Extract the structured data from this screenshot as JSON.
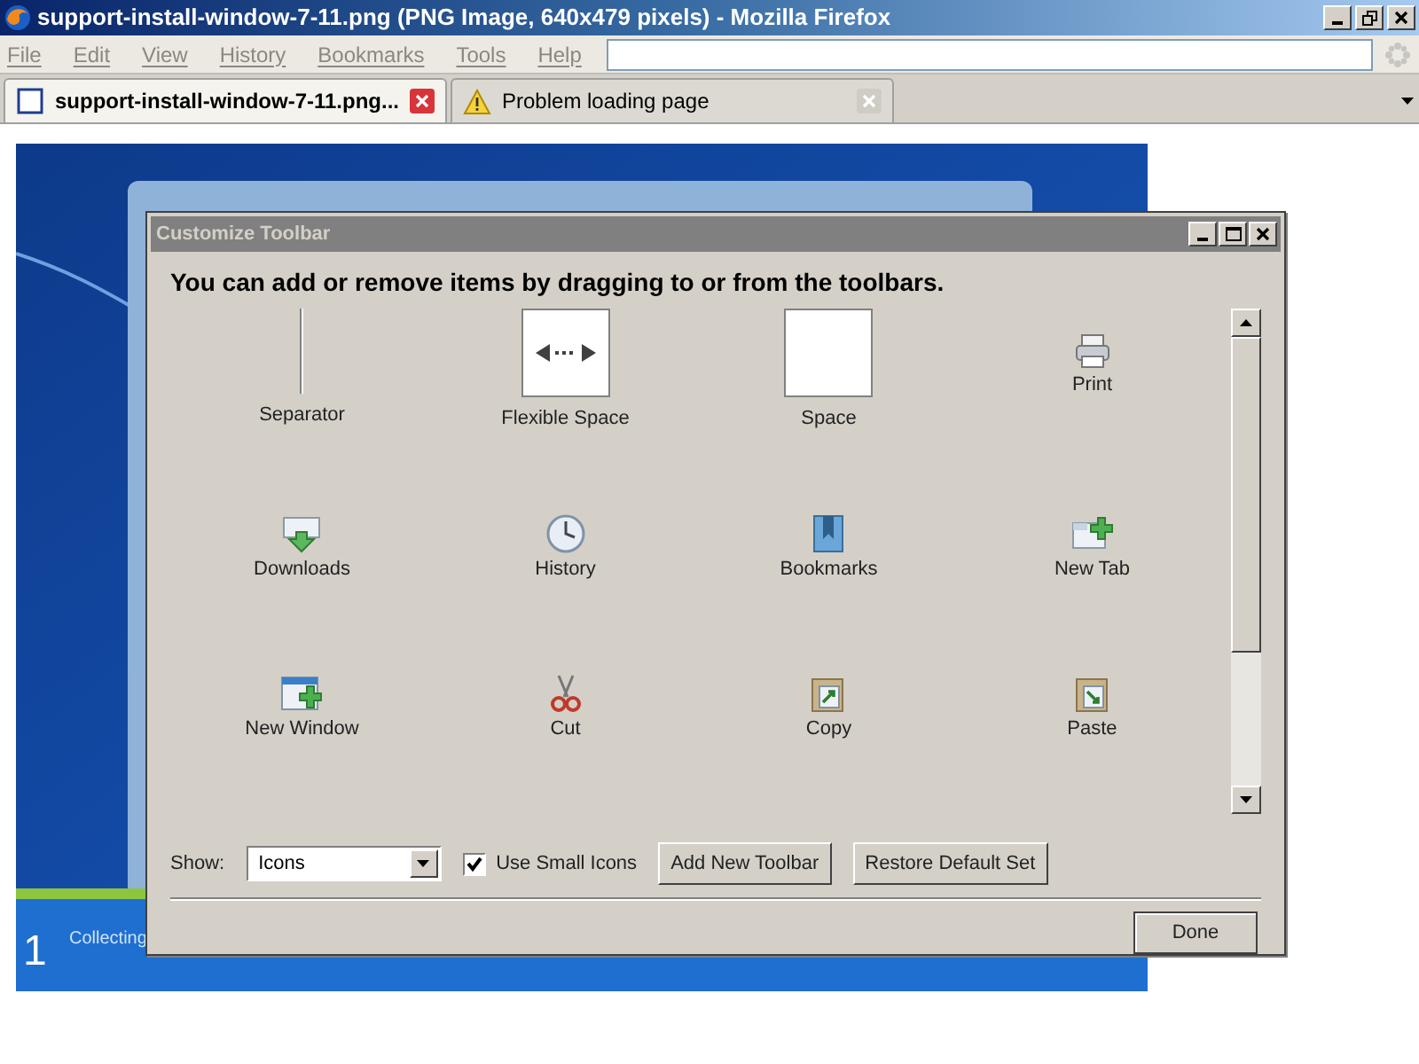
{
  "window": {
    "title": "support-install-window-7-11.png (PNG Image, 640x479 pixels) - Mozilla Firefox"
  },
  "menu": [
    "File",
    "Edit",
    "View",
    "History",
    "Bookmarks",
    "Tools",
    "Help"
  ],
  "tabs": [
    {
      "label": "support-install-window-7-11.png...",
      "selected": true,
      "kind": "image"
    },
    {
      "label": "Problem loading page",
      "selected": false,
      "kind": "warning"
    }
  ],
  "image": {
    "step_1": "1",
    "step_1_label": "Collecting"
  },
  "dialog": {
    "title": "Customize Toolbar",
    "heading": "You can add or remove items by dragging to or from the toolbars.",
    "items": [
      {
        "label": "Separator",
        "kind": "separator"
      },
      {
        "label": "Flexible Space",
        "kind": "flexible-space"
      },
      {
        "label": "Space",
        "kind": "space"
      },
      {
        "label": "Print",
        "kind": "button"
      },
      {
        "label": "Downloads",
        "kind": "button"
      },
      {
        "label": "History",
        "kind": "button"
      },
      {
        "label": "Bookmarks",
        "kind": "button"
      },
      {
        "label": "New Tab",
        "kind": "button"
      },
      {
        "label": "New Window",
        "kind": "button"
      },
      {
        "label": "Cut",
        "kind": "button"
      },
      {
        "label": "Copy",
        "kind": "button"
      },
      {
        "label": "Paste",
        "kind": "button"
      }
    ],
    "show_label": "Show:",
    "show_value": "Icons",
    "small_icons": {
      "label": "Use Small Icons",
      "checked": true
    },
    "buttons": [
      "Add New Toolbar",
      "Restore Default Set"
    ],
    "done": "Done"
  }
}
